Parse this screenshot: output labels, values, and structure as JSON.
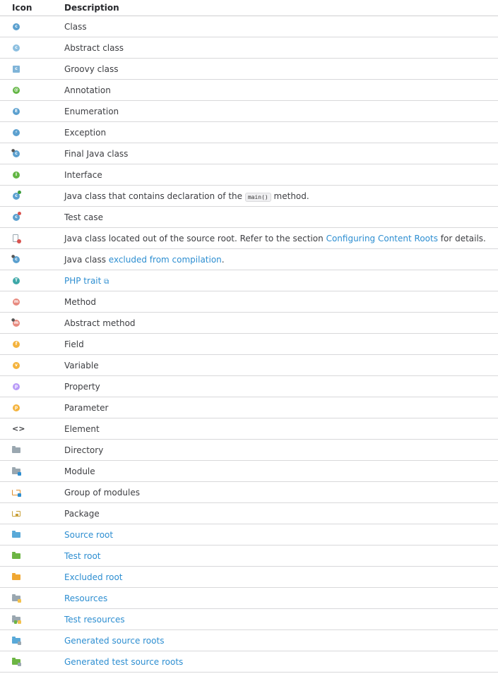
{
  "header": {
    "icon_col": "Icon",
    "desc_col": "Description"
  },
  "rows": [
    {
      "icon": "class-icon",
      "text": "Class"
    },
    {
      "icon": "abstract-class-icon",
      "text": "Abstract class"
    },
    {
      "icon": "groovy-class-icon",
      "text": "Groovy class"
    },
    {
      "icon": "annotation-icon",
      "text": "Annotation"
    },
    {
      "icon": "enumeration-icon",
      "text": "Enumeration"
    },
    {
      "icon": "exception-icon",
      "text": "Exception"
    },
    {
      "icon": "final-java-class-icon",
      "text": "Final Java class"
    },
    {
      "icon": "interface-icon",
      "text": "Interface"
    },
    {
      "icon": "main-class-icon",
      "pre": "Java class that contains declaration of the ",
      "code": "main()",
      "post": " method."
    },
    {
      "icon": "test-case-icon",
      "text": "Test case"
    },
    {
      "icon": "out-of-root-class-icon",
      "pre": "Java class located out of the source root. Refer to the section ",
      "link": "Configuring Content Roots",
      "post": " for details."
    },
    {
      "icon": "excluded-class-icon",
      "pre": "Java class ",
      "link": "excluded from compilation",
      "post": "."
    },
    {
      "icon": "php-trait-icon",
      "link": "PHP trait",
      "ext": "⧉"
    },
    {
      "icon": "method-icon",
      "text": "Method"
    },
    {
      "icon": "abstract-method-icon",
      "text": "Abstract method"
    },
    {
      "icon": "field-icon",
      "text": "Field"
    },
    {
      "icon": "variable-icon",
      "text": "Variable"
    },
    {
      "icon": "property-icon",
      "text": "Property"
    },
    {
      "icon": "parameter-icon",
      "text": "Parameter"
    },
    {
      "icon": "element-icon",
      "text": "Element"
    },
    {
      "icon": "directory-icon",
      "text": "Directory"
    },
    {
      "icon": "module-icon",
      "text": "Module"
    },
    {
      "icon": "module-group-icon",
      "text": "Group of modules"
    },
    {
      "icon": "package-icon",
      "text": "Package"
    },
    {
      "icon": "source-root-icon",
      "link": "Source root"
    },
    {
      "icon": "test-root-icon",
      "link": "Test root"
    },
    {
      "icon": "excluded-root-icon",
      "link": "Excluded root"
    },
    {
      "icon": "resources-icon",
      "link": "Resources"
    },
    {
      "icon": "test-resources-icon",
      "link": "Test resources"
    },
    {
      "icon": "generated-source-roots-icon",
      "link": "Generated source roots"
    },
    {
      "icon": "generated-test-source-roots-icon",
      "link": "Generated test source roots"
    }
  ],
  "icons": {
    "class-icon": {
      "shape": "circle",
      "color": "#5ba0cf",
      "letter": "c"
    },
    "abstract-class-icon": {
      "shape": "circle",
      "color": "#8cbfe0",
      "letter": "c"
    },
    "groovy-class-icon": {
      "shape": "square",
      "color": "#7fb4d8",
      "letter": "c"
    },
    "annotation-icon": {
      "shape": "circle",
      "color": "#62b543",
      "letter": "@"
    },
    "enumeration-icon": {
      "shape": "circle",
      "color": "#5ba0cf",
      "letter": "E"
    },
    "exception-icon": {
      "shape": "circle",
      "color": "#5ba0cf",
      "letter": "⚡"
    },
    "final-java-class-icon": {
      "shape": "circle",
      "color": "#5ba0cf",
      "letter": "c",
      "pin": true
    },
    "interface-icon": {
      "shape": "circle",
      "color": "#62b543",
      "letter": "I"
    },
    "main-class-icon": {
      "shape": "circle",
      "color": "#5ba0cf",
      "letter": "c",
      "badge": "#3d9e3d"
    },
    "test-case-icon": {
      "shape": "circle",
      "color": "#5ba0cf",
      "letter": "c",
      "badge": "#d9534f"
    },
    "out-of-root-class-icon": {
      "shape": "file",
      "color": "#9aa7b0",
      "badge": "#d9534f"
    },
    "excluded-class-icon": {
      "shape": "circle",
      "color": "#5ba0cf",
      "letter": "c",
      "pin": true
    },
    "php-trait-icon": {
      "shape": "circle",
      "color": "#3da8a8",
      "letter": "T"
    },
    "method-icon": {
      "shape": "circle",
      "color": "#e88a7f",
      "letter": "m"
    },
    "abstract-method-icon": {
      "shape": "circle",
      "color": "#e88a7f",
      "letter": "m",
      "pin": true
    },
    "field-icon": {
      "shape": "circle",
      "color": "#f4b33d",
      "letter": "f"
    },
    "variable-icon": {
      "shape": "circle",
      "color": "#f4b33d",
      "letter": "v"
    },
    "property-icon": {
      "shape": "circle",
      "color": "#b99bf8",
      "letter": "p"
    },
    "parameter-icon": {
      "shape": "circle",
      "color": "#f4b33d",
      "letter": "p"
    },
    "element-icon": {
      "shape": "glyph",
      "color": "#3d3e42",
      "letter": "<>"
    },
    "directory-icon": {
      "shape": "folder",
      "color": "#9aa7b0"
    },
    "module-icon": {
      "shape": "folder",
      "color": "#9aa7b0",
      "mini": "#2d8ed1"
    },
    "module-group-icon": {
      "shape": "folder-outline",
      "color": "#e0902f",
      "mini": "#2d8ed1"
    },
    "package-icon": {
      "shape": "package",
      "color": "#c9a13a"
    },
    "source-root-icon": {
      "shape": "folder",
      "color": "#59a9d8"
    },
    "test-root-icon": {
      "shape": "folder",
      "color": "#6cb543"
    },
    "excluded-root-icon": {
      "shape": "folder",
      "color": "#f0a732"
    },
    "resources-icon": {
      "shape": "folder",
      "color": "#9aa7b0",
      "mini": "#f4c24d"
    },
    "test-resources-icon": {
      "shape": "folder",
      "color": "#9aa7b0",
      "mini": "#f4c24d",
      "mini2": "#6cb543"
    },
    "generated-source-roots-icon": {
      "shape": "folder",
      "color": "#59a9d8",
      "mini": "#9aa7b0"
    },
    "generated-test-source-roots-icon": {
      "shape": "folder",
      "color": "#6cb543",
      "mini": "#9aa7b0"
    }
  }
}
